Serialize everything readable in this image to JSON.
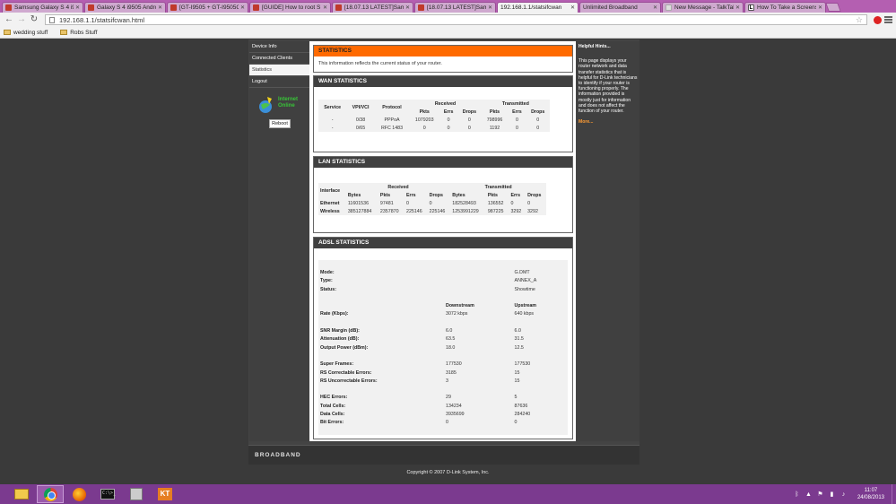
{
  "tabs": [
    {
      "title": "Samsung Galaxy S 4 i95",
      "icon": "forum-favicon"
    },
    {
      "title": "Galaxy S 4 i9505 Androi",
      "icon": "forum-favicon"
    },
    {
      "title": "[GT-I9505 + GT-I9505G",
      "icon": "forum-favicon"
    },
    {
      "title": "[GUIDE] How to root S",
      "icon": "forum-favicon"
    },
    {
      "title": "[18.07.13 LATEST]Sams",
      "icon": "forum-favicon"
    },
    {
      "title": "[18.07.13 LATEST]Sams",
      "icon": "forum-favicon"
    },
    {
      "title": "192.168.1.1/statsifcwan",
      "icon": "page-favicon",
      "active": true
    },
    {
      "title": "Unlimited Broadband",
      "icon": "page-favicon"
    },
    {
      "title": "New Message - TalkTal",
      "icon": "mail-favicon"
    },
    {
      "title": "How To Take a Screens",
      "icon": "l-favicon"
    }
  ],
  "toolbar": {
    "url": "192.168.1.1/statsifcwan.html"
  },
  "bookmarks": [
    {
      "label": "wedding stuff"
    },
    {
      "label": "Robs Stuff"
    }
  ],
  "nav": {
    "items": [
      {
        "label": "Device Info"
      },
      {
        "label": "Connected Clients"
      },
      {
        "label": "Statistics",
        "selected": true
      },
      {
        "label": "Logout"
      }
    ],
    "status_line1": "Internet",
    "status_line2": "Online",
    "reboot": "Reboot"
  },
  "statistics": {
    "title": "STATISTICS",
    "intro": "This information reflects the current status of your router."
  },
  "wan": {
    "title": "WAN STATISTICS",
    "headers": {
      "service": "Service",
      "vpi": "VPI/VCI",
      "protocol": "Protocol",
      "received": "Received",
      "transmitted": "Transmitted"
    },
    "sub": {
      "pkts": "Pkts",
      "errs": "Errs",
      "drops": "Drops"
    },
    "rows": [
      {
        "service": "-",
        "vpi": "0/38",
        "protocol": "PPPoA",
        "rx_pkts": "1079203",
        "rx_errs": "0",
        "rx_drops": "0",
        "tx_pkts": "798996",
        "tx_errs": "0",
        "tx_drops": "0"
      },
      {
        "service": "-",
        "vpi": "0/65",
        "protocol": "RFC 1483",
        "rx_pkts": "0",
        "rx_errs": "0",
        "rx_drops": "0",
        "tx_pkts": "1192",
        "tx_errs": "0",
        "tx_drops": "0"
      }
    ]
  },
  "lan": {
    "title": "LAN STATISTICS",
    "headers": {
      "interface": "Interface",
      "received": "Received",
      "transmitted": "Transmitted"
    },
    "sub": {
      "bytes": "Bytes",
      "pkts": "Pkts",
      "errs": "Errs",
      "drops": "Drops"
    },
    "rows": [
      {
        "iface": "Ethernet",
        "rx_bytes": "11601536",
        "rx_pkts": "97481",
        "rx_errs": "0",
        "rx_drops": "0",
        "tx_bytes": "182528493",
        "tx_pkts": "136552",
        "tx_errs": "0",
        "tx_drops": "0"
      },
      {
        "iface": "Wireless",
        "rx_bytes": "385127884",
        "rx_pkts": "2357870",
        "rx_errs": "225146",
        "rx_drops": "225146",
        "tx_bytes": "1253991229",
        "tx_pkts": "987225",
        "tx_errs": "3292",
        "tx_drops": "3292"
      }
    ]
  },
  "adsl": {
    "title": "ADSL STATISTICS",
    "mode_label": "Mode:",
    "mode": "G.DMT",
    "type_label": "Type:",
    "type": "ANNEX_A",
    "status_label": "Status:",
    "status": "Showtime",
    "downstream": "Downstream",
    "upstream": "Upstream",
    "rate_label": "Rate (Kbps):",
    "rate_down": "3072 kbps",
    "rate_up": "640 kbps",
    "snr_label": "SNR Margin (dB):",
    "snr_down": "6.0",
    "snr_up": "6.0",
    "atten_label": "Attenuation (dB):",
    "atten_down": "63.5",
    "atten_up": "31.5",
    "power_label": "Output Power (dBm):",
    "power_down": "18.0",
    "power_up": "12.5",
    "frames_label": "Super Frames:",
    "frames_down": "177530",
    "frames_up": "177530",
    "rscorr_label": "RS Correctable Errors:",
    "rscorr_down": "3185",
    "rscorr_up": "15",
    "rsunc_label": "RS Uncorrectable Errors:",
    "rsunc_down": "3",
    "rsunc_up": "15",
    "hec_label": "HEC Errors:",
    "hec_down": "29",
    "hec_up": "5",
    "total_label": "Total Cells:",
    "total_down": "134234",
    "total_up": "87636",
    "data_label": "Data Cells:",
    "data_down": "3935699",
    "data_up": "284240",
    "bit_label": "Bit Errors:",
    "bit_down": "0",
    "bit_up": "0"
  },
  "hints": {
    "title": "Helpful Hints...",
    "body": "This page displays your router network and data transfer statistics that is helpful for D-Link technicians to identify if your router is functioning properly. The information provided is mostly just for information and does not affect the function of your router.",
    "more": "More..."
  },
  "footer": {
    "brand": "BROADBAND",
    "copyright": "Copyright © 2007 D-Link System, Inc."
  },
  "taskbar": {
    "cmd_text": "C:\\>_",
    "kt_label": "KT",
    "time": "11:07",
    "date": "24/08/2013"
  },
  "colors": {
    "accent": "#ff6a00",
    "taskbar": "#7b3a8f",
    "online": "#38c438"
  }
}
